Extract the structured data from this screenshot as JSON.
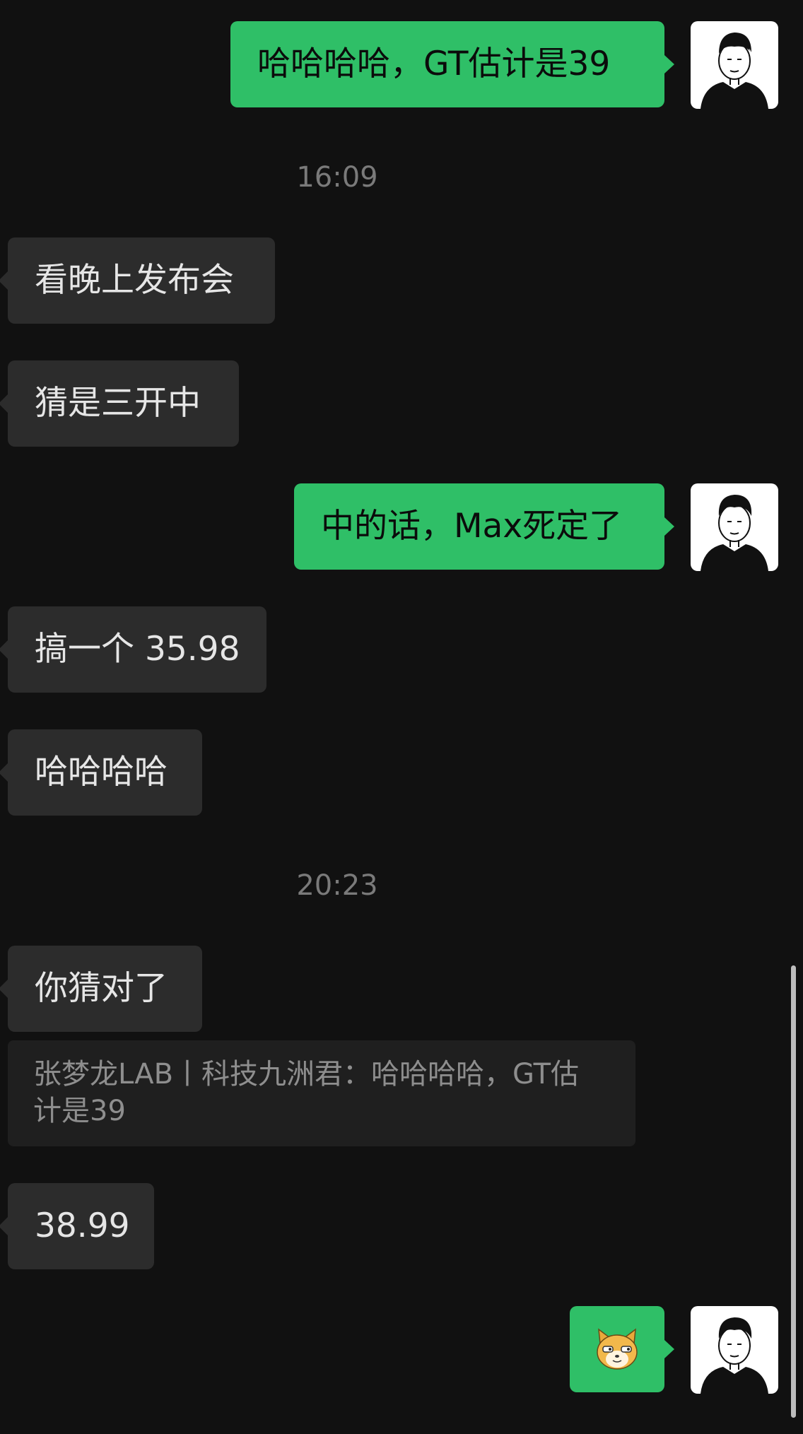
{
  "messages": [
    {
      "side": "out",
      "text": "哈哈哈哈，GT估计是39"
    },
    {
      "side": "time",
      "text": "16:09"
    },
    {
      "side": "in",
      "text": "看晚上发布会"
    },
    {
      "side": "in",
      "text": "猜是三开中"
    },
    {
      "side": "out",
      "text": "中的话，Max死定了"
    },
    {
      "side": "in",
      "text": "搞一个 35.98"
    },
    {
      "side": "in",
      "text": "哈哈哈哈"
    },
    {
      "side": "time",
      "text": "20:23"
    },
    {
      "side": "in",
      "text": "你猜对了"
    },
    {
      "side": "quote",
      "line1": "张梦龙LAB丨科技九洲君：哈哈哈哈，GT估",
      "line2": "计是39"
    },
    {
      "side": "in",
      "text": "38.99"
    },
    {
      "side": "out",
      "sticker": "doge-cat-sticker"
    }
  ],
  "colors": {
    "background": "#111111",
    "outgoing_bubble": "#2fbf67",
    "incoming_bubble": "#2c2c2c",
    "timestamp": "#7a7a7a"
  },
  "avatar": {
    "icon": "user-avatar-sketch"
  }
}
